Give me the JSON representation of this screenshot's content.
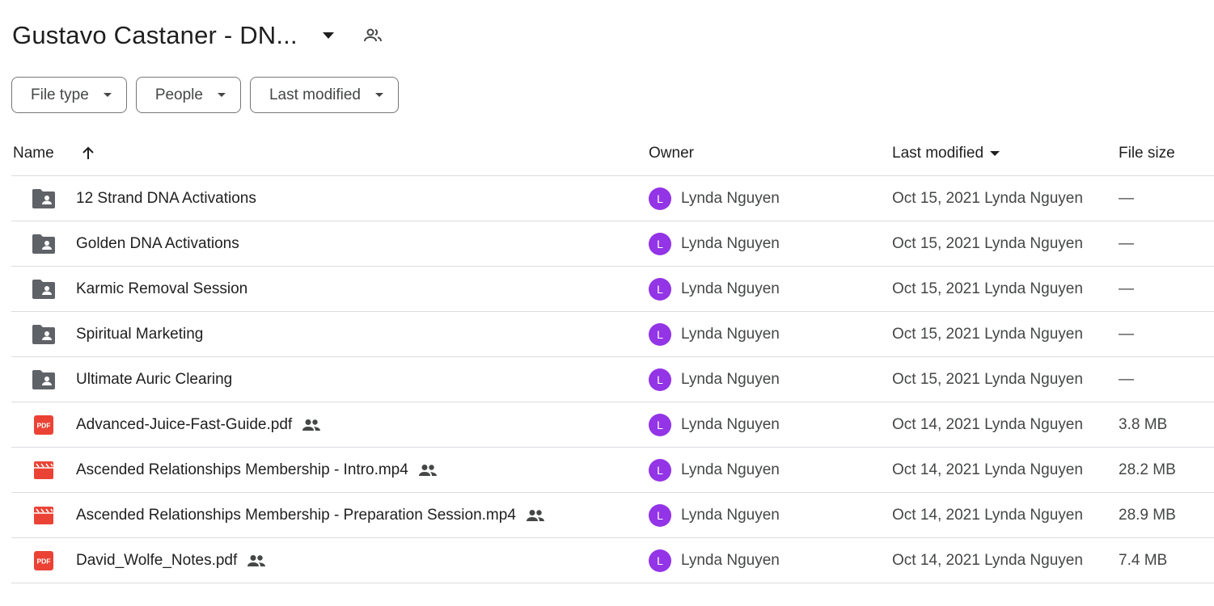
{
  "header": {
    "title": "Gustavo Castaner - DN...",
    "caret_icon": "arrow-drop-down-icon",
    "shared_icon": "people-icon"
  },
  "filters": [
    {
      "label": "File type"
    },
    {
      "label": "People"
    },
    {
      "label": "Last modified"
    }
  ],
  "columns": {
    "name": "Name",
    "owner": "Owner",
    "last_modified": "Last modified",
    "file_size": "File size"
  },
  "rows": [
    {
      "name": "12 Strand DNA Activations",
      "type": "shared-folder",
      "shared": false,
      "owner_initial": "L",
      "owner": "Lynda Nguyen",
      "modified": "Oct 15, 2021 Lynda Nguyen",
      "size": "—"
    },
    {
      "name": "Golden DNA Activations",
      "type": "shared-folder",
      "shared": false,
      "owner_initial": "L",
      "owner": "Lynda Nguyen",
      "modified": "Oct 15, 2021 Lynda Nguyen",
      "size": "—"
    },
    {
      "name": "Karmic Removal Session",
      "type": "shared-folder",
      "shared": false,
      "owner_initial": "L",
      "owner": "Lynda Nguyen",
      "modified": "Oct 15, 2021 Lynda Nguyen",
      "size": "—"
    },
    {
      "name": "Spiritual Marketing",
      "type": "shared-folder",
      "shared": false,
      "owner_initial": "L",
      "owner": "Lynda Nguyen",
      "modified": "Oct 15, 2021 Lynda Nguyen",
      "size": "—"
    },
    {
      "name": "Ultimate Auric Clearing",
      "type": "shared-folder",
      "shared": false,
      "owner_initial": "L",
      "owner": "Lynda Nguyen",
      "modified": "Oct 15, 2021 Lynda Nguyen",
      "size": "—"
    },
    {
      "name": "Advanced-Juice-Fast-Guide.pdf",
      "type": "pdf",
      "shared": true,
      "owner_initial": "L",
      "owner": "Lynda Nguyen",
      "modified": "Oct 14, 2021 Lynda Nguyen",
      "size": "3.8 MB"
    },
    {
      "name": "Ascended Relationships Membership - Intro.mp4",
      "type": "video",
      "shared": true,
      "owner_initial": "L",
      "owner": "Lynda Nguyen",
      "modified": "Oct 14, 2021 Lynda Nguyen",
      "size": "28.2 MB"
    },
    {
      "name": "Ascended Relationships Membership - Preparation Session.mp4",
      "type": "video",
      "shared": true,
      "owner_initial": "L",
      "owner": "Lynda Nguyen",
      "modified": "Oct 14, 2021 Lynda Nguyen",
      "size": "28.9 MB"
    },
    {
      "name": "David_Wolfe_Notes.pdf",
      "type": "pdf",
      "shared": true,
      "owner_initial": "L",
      "owner": "Lynda Nguyen",
      "modified": "Oct 14, 2021 Lynda Nguyen",
      "size": "7.4 MB"
    }
  ],
  "pdf_badge": "PDF",
  "colors": {
    "avatar": "#9334e6",
    "pdf": "#ea4335",
    "video": "#ea4335",
    "folder": "#5f6368"
  }
}
